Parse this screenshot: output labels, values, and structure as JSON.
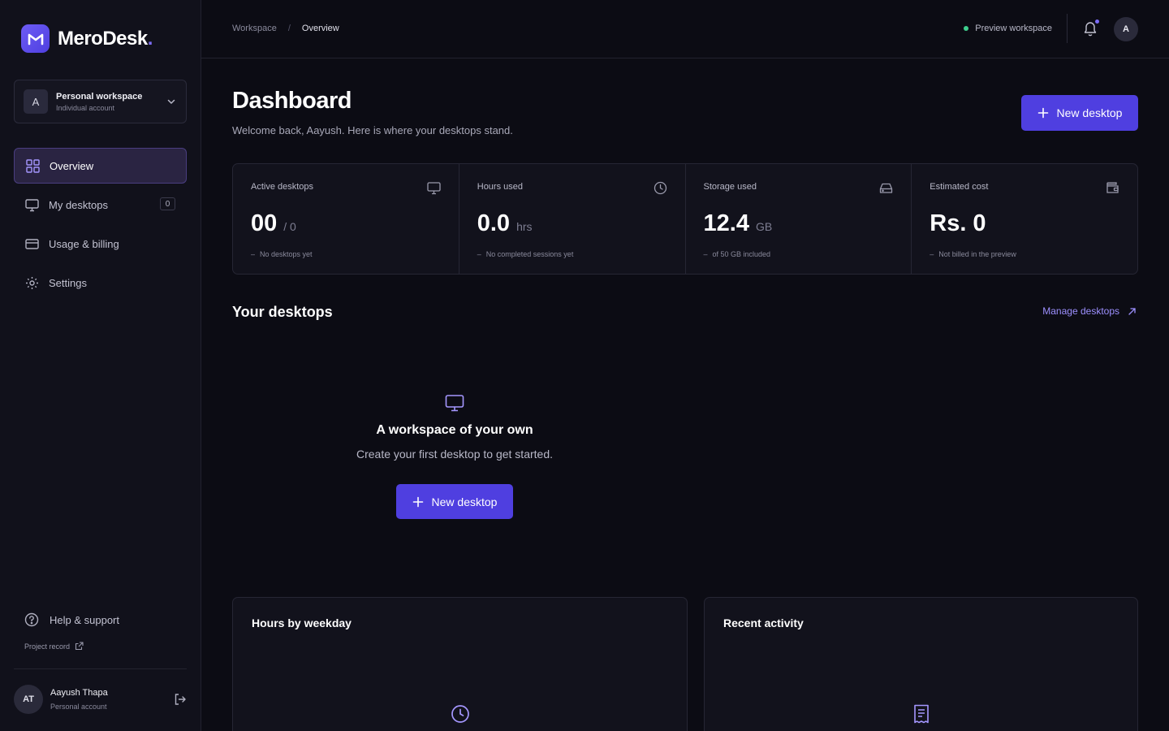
{
  "brand": {
    "name": "MeroDesk",
    "dot": "."
  },
  "workspace": {
    "avatar": "A",
    "name": "Personal workspace",
    "sub": "Individual account"
  },
  "nav": {
    "items": [
      {
        "label": "Overview",
        "icon": "grid-icon"
      },
      {
        "label": "My desktops",
        "icon": "monitor-icon",
        "badge": "0"
      },
      {
        "label": "Usage & billing",
        "icon": "credit-card-icon"
      },
      {
        "label": "Settings",
        "icon": "gear-icon"
      }
    ],
    "active": "Overview"
  },
  "footer": {
    "help": "Help & support",
    "project_record": "Project record",
    "user_initials": "AT",
    "user_name": "Aayush Thapa",
    "user_sub": "Personal account"
  },
  "topbar": {
    "crumb_root": "Workspace",
    "crumb_sep": "/",
    "crumb_current": "Overview",
    "preview": "Preview workspace",
    "avatar": "A"
  },
  "header": {
    "title": "Dashboard",
    "subtitle": "Welcome back, Aayush. Here is where your desktops stand.",
    "new_desktop": "New desktop"
  },
  "stats": [
    {
      "label": "Active desktops",
      "value": "00",
      "unit": "/ 0",
      "note": "No desktops yet",
      "icon": "monitor-icon"
    },
    {
      "label": "Hours used",
      "value": "0.0",
      "unit": "hrs",
      "note": "No completed sessions yet",
      "icon": "clock-icon"
    },
    {
      "label": "Storage used",
      "value": "12.4",
      "unit": "GB",
      "note": "of 50 GB included",
      "icon": "hard-drive-icon"
    },
    {
      "label": "Estimated cost",
      "value": "Rs. 0",
      "unit": "",
      "note": "Not billed in the preview",
      "icon": "wallet-icon"
    }
  ],
  "stat_note_prefix": "–",
  "desktops": {
    "title": "Your desktops",
    "manage": "Manage desktops",
    "empty_title": "A workspace of your own",
    "empty_sub": "Create your first desktop to get started.",
    "new_desktop": "New desktop"
  },
  "panels": {
    "hours_title": "Hours by weekday",
    "activity_title": "Recent activity"
  },
  "colors": {
    "accent": "#4f3fe0",
    "accent_light": "#9d90ff",
    "status_online": "#3ecf8e",
    "background": "#0c0c14"
  }
}
